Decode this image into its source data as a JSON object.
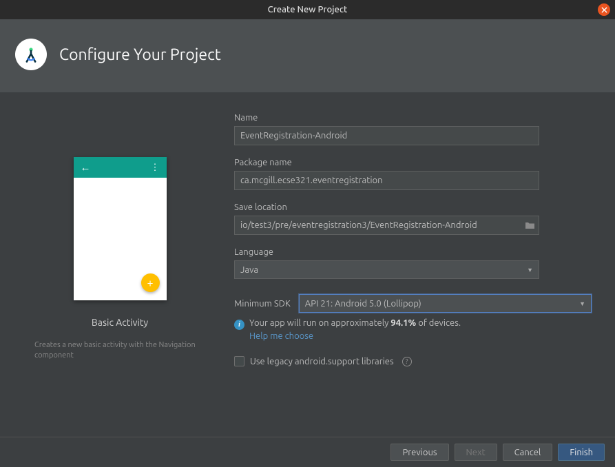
{
  "window": {
    "title": "Create New Project"
  },
  "header": {
    "title": "Configure Your Project"
  },
  "template": {
    "name": "Basic Activity",
    "description": "Creates a new basic activity with the Navigation component"
  },
  "form": {
    "name_label": "Name",
    "name_value": "EventRegistration-Android",
    "package_label": "Package name",
    "package_value": "ca.mcgill.ecse321.eventregistration",
    "save_location_label": "Save location",
    "save_location_value": "io/test3/pre/eventregistration3/EventRegistration-Android",
    "language_label": "Language",
    "language_value": "Java",
    "min_sdk_label": "Minimum SDK",
    "min_sdk_value": "API 21: Android 5.0 (Lollipop)",
    "compat_prefix": "Your app will run on approximately ",
    "compat_pct": "94.1%",
    "compat_suffix": " of devices.",
    "help_link": "Help me choose",
    "legacy_label": "Use legacy android.support libraries"
  },
  "buttons": {
    "previous": "Previous",
    "next": "Next",
    "cancel": "Cancel",
    "finish": "Finish"
  }
}
